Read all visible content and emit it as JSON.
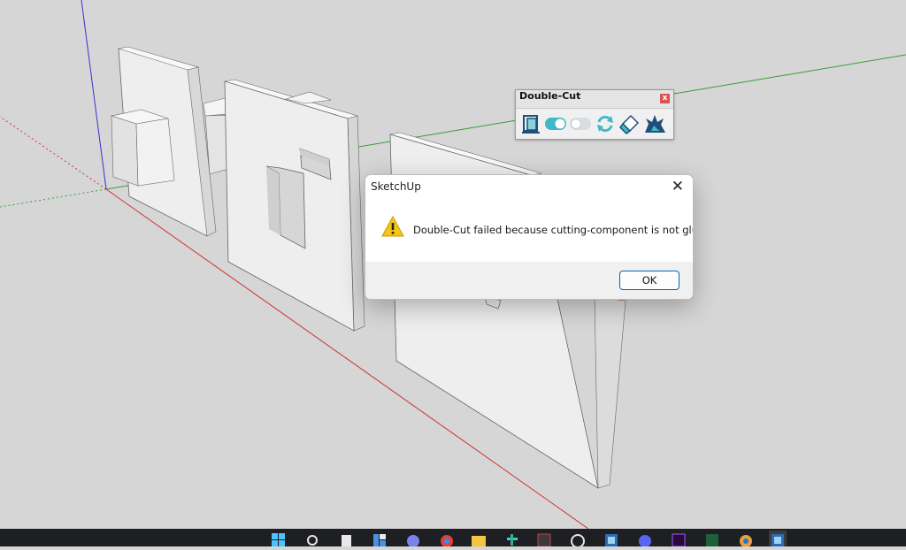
{
  "toolbar": {
    "title": "Double-Cut",
    "close_label": "x",
    "icons": [
      "double-cut-icon",
      "toggle-on-icon",
      "toggle-off-icon",
      "refresh-icon",
      "eraser-icon",
      "explode-icon"
    ]
  },
  "dialog": {
    "title": "SketchUp",
    "close_label": "✕",
    "message": "Double-Cut failed because cutting-component is not glued to a face.",
    "ok_label": "OK",
    "icon": "warning-icon"
  },
  "taskbar": {
    "apps": [
      "windows-start-icon",
      "search-icon",
      "file-icon",
      "widgets-icon",
      "teams-icon",
      "chrome-icon",
      "folder-icon",
      "slack-icon",
      "app-icon",
      "whatsapp-icon",
      "sketchup-icon",
      "discord-icon",
      "premiere-icon",
      "editor-icon",
      "chrome-alt-icon",
      "sketchup-active-icon"
    ]
  },
  "colors": {
    "viewport_bg": "#d6d6d6",
    "axis_red": "#cc3333",
    "axis_green": "#3a9a3a",
    "axis_blue": "#3333cc",
    "accent": "#0067c0",
    "taskbar": "#1e1f22"
  }
}
